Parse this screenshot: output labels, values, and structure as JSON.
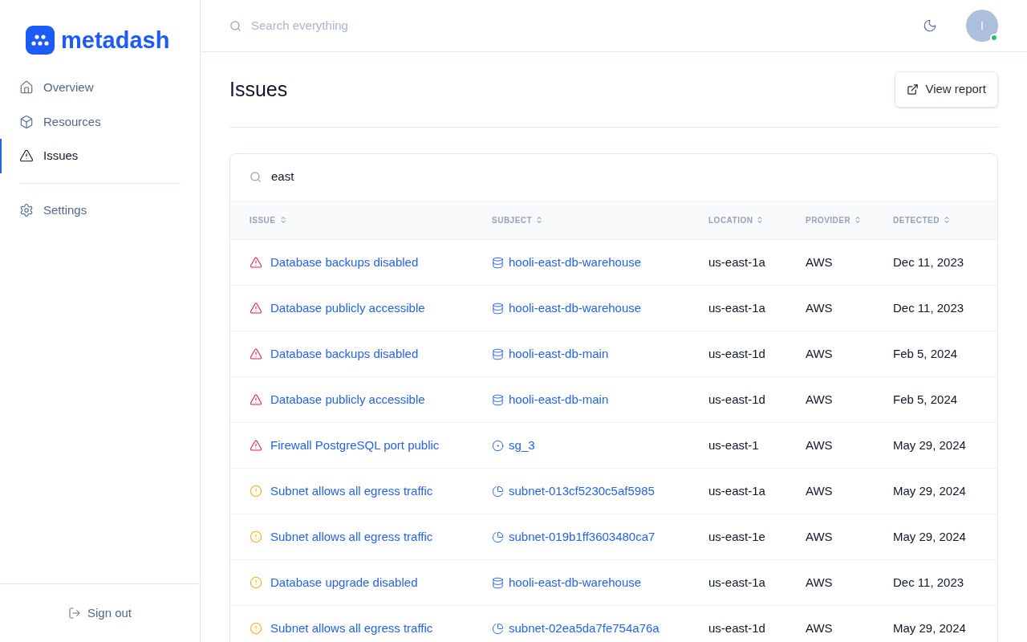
{
  "brand": {
    "name": "metadash"
  },
  "nav": [
    {
      "label": "Overview",
      "kind": "home",
      "selected": false
    },
    {
      "label": "Resources",
      "kind": "box",
      "selected": false
    },
    {
      "label": "Issues",
      "kind": "alert",
      "selected": true
    }
  ],
  "nav_secondary": [
    {
      "label": "Settings",
      "kind": "settings",
      "selected": false
    }
  ],
  "sign_out": {
    "label": "Sign out"
  },
  "header": {
    "search": {
      "placeholder": "Search everything"
    },
    "avatar": {
      "initial": "I",
      "online": true
    }
  },
  "page": {
    "title": "Issues",
    "action": "View report"
  },
  "filter": {
    "value": "east"
  },
  "table": {
    "columns": [
      "ISSUE",
      "SUBJECT",
      "LOCATION",
      "PROVIDER",
      "DETECTED"
    ],
    "rows": [
      {
        "issue": {
          "kind": "critical",
          "text": "Database backups disabled"
        },
        "subject": {
          "kind": "database",
          "text": "hooli-east-db-warehouse"
        },
        "location": "us-east-1a",
        "provider": "AWS",
        "detected": "Dec 11, 2023"
      },
      {
        "issue": {
          "kind": "critical",
          "text": "Database publicly accessible"
        },
        "subject": {
          "kind": "database",
          "text": "hooli-east-db-warehouse"
        },
        "location": "us-east-1a",
        "provider": "AWS",
        "detected": "Dec 11, 2023"
      },
      {
        "issue": {
          "kind": "critical",
          "text": "Database backups disabled"
        },
        "subject": {
          "kind": "database",
          "text": "hooli-east-db-main"
        },
        "location": "us-east-1d",
        "provider": "AWS",
        "detected": "Feb 5, 2024"
      },
      {
        "issue": {
          "kind": "critical",
          "text": "Database publicly accessible"
        },
        "subject": {
          "kind": "database",
          "text": "hooli-east-db-main"
        },
        "location": "us-east-1d",
        "provider": "AWS",
        "detected": "Feb 5, 2024"
      },
      {
        "issue": {
          "kind": "critical",
          "text": "Firewall PostgreSQL port public"
        },
        "subject": {
          "kind": "group",
          "text": "sg_3"
        },
        "location": "us-east-1",
        "provider": "AWS",
        "detected": "May 29, 2024"
      },
      {
        "issue": {
          "kind": "warning",
          "text": "Subnet allows all egress traffic"
        },
        "subject": {
          "kind": "subnet",
          "text": "subnet-013cf5230c5af5985"
        },
        "location": "us-east-1a",
        "provider": "AWS",
        "detected": "May 29, 2024"
      },
      {
        "issue": {
          "kind": "warning",
          "text": "Subnet allows all egress traffic"
        },
        "subject": {
          "kind": "subnet",
          "text": "subnet-019b1ff3603480ca7"
        },
        "location": "us-east-1e",
        "provider": "AWS",
        "detected": "May 29, 2024"
      },
      {
        "issue": {
          "kind": "warning",
          "text": "Database upgrade disabled"
        },
        "subject": {
          "kind": "database",
          "text": "hooli-east-db-warehouse"
        },
        "location": "us-east-1a",
        "provider": "AWS",
        "detected": "Dec 11, 2023"
      },
      {
        "issue": {
          "kind": "warning",
          "text": "Subnet allows all egress traffic"
        },
        "subject": {
          "kind": "subnet",
          "text": "subnet-02ea5da7fe754a76a"
        },
        "location": "us-east-1d",
        "provider": "AWS",
        "detected": "May 29, 2024"
      }
    ]
  }
}
